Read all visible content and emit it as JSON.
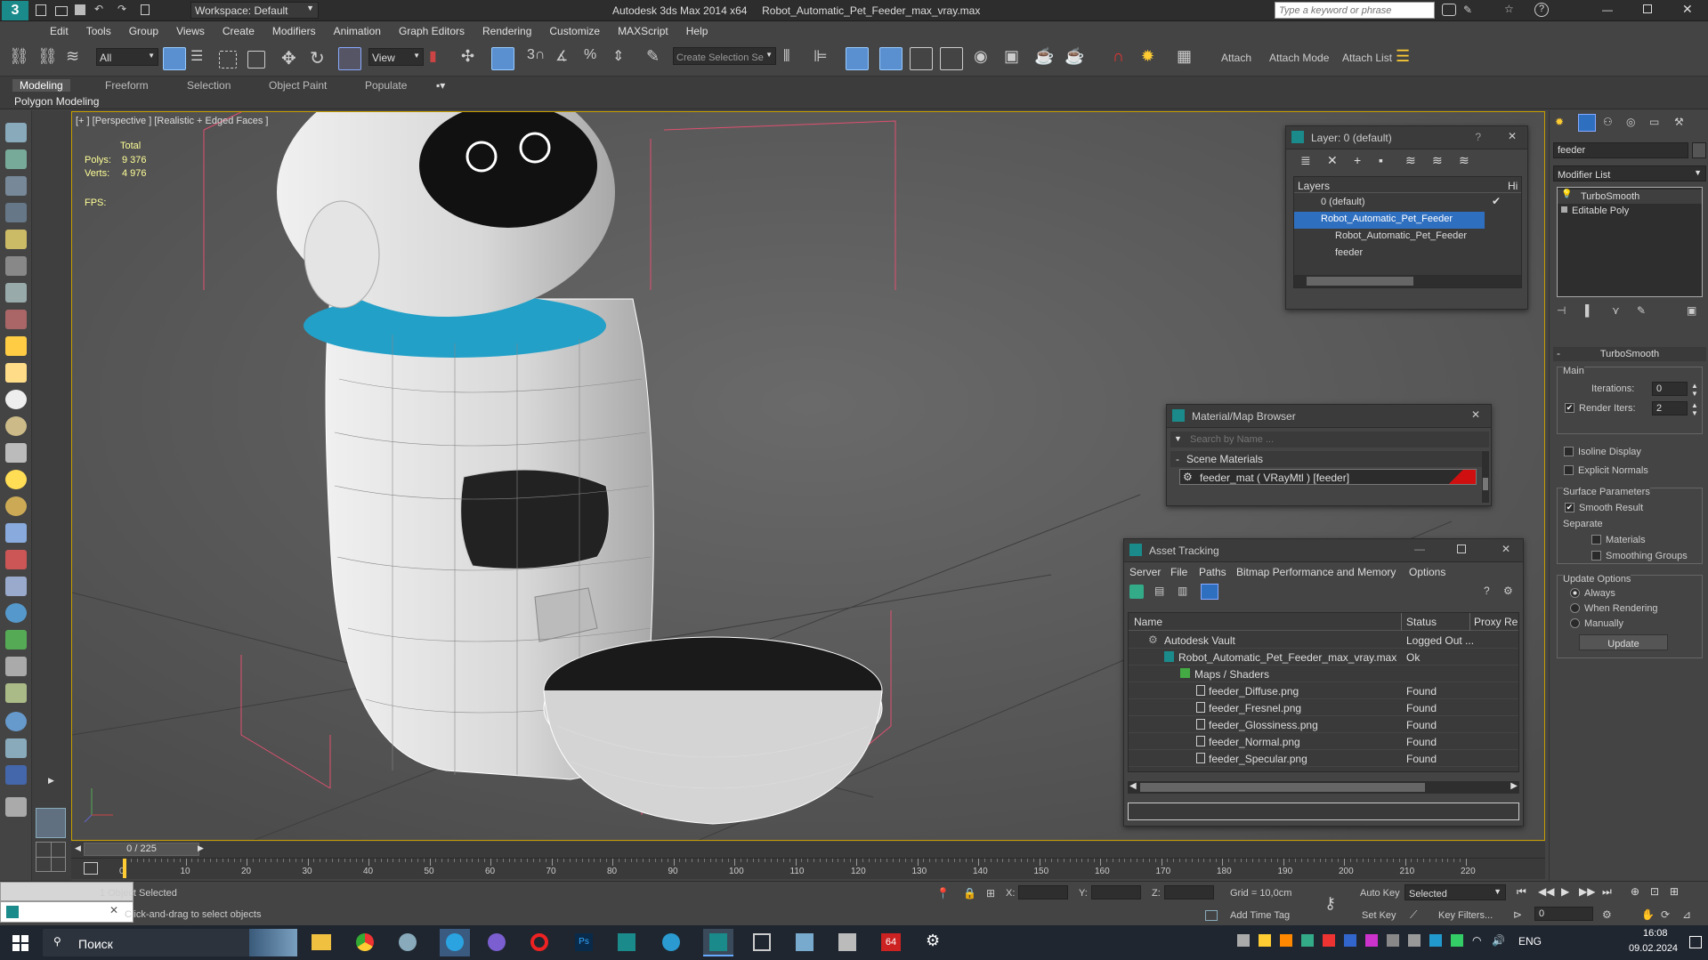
{
  "titlebar": {
    "workspace": "Workspace: Default",
    "app": "Autodesk 3ds Max  2014 x64",
    "file": "Robot_Automatic_Pet_Feeder_max_vray.max",
    "search_placeholder": "Type a keyword or phrase"
  },
  "menu": [
    "Edit",
    "Tools",
    "Group",
    "Views",
    "Create",
    "Modifiers",
    "Animation",
    "Graph Editors",
    "Rendering",
    "Customize",
    "MAXScript",
    "Help"
  ],
  "toolbar": {
    "filter": "All",
    "ref_coord": "View",
    "selection_set": "Create Selection Se",
    "attach": "Attach",
    "attach_mode": "Attach Mode",
    "attach_list": "Attach List"
  },
  "ribbon": {
    "tabs": [
      "Modeling",
      "Freeform",
      "Selection",
      "Object Paint",
      "Populate"
    ],
    "sub": "Polygon Modeling"
  },
  "viewport": {
    "label": "[+ ] [Perspective ] [Realistic + Edged Faces ]",
    "stats_total": "Total",
    "polys_label": "Polys:",
    "polys": "9 376",
    "verts_label": "Verts:",
    "verts": "4 976",
    "fps": "FPS:"
  },
  "layer_panel": {
    "title": "Layer: 0 (default)",
    "header": "Layers",
    "hide_col": "Hi",
    "items": [
      "0 (default)",
      "Robot_Automatic_Pet_Feeder",
      "Robot_Automatic_Pet_Feeder",
      "feeder"
    ]
  },
  "material_browser": {
    "title": "Material/Map Browser",
    "search_placeholder": "Search by Name ...",
    "section": "Scene Materials",
    "item": "feeder_mat  ( VRayMtl )  [feeder]",
    "swatch_color": "#d01010"
  },
  "asset_tracking": {
    "title": "Asset Tracking",
    "menu": [
      "Server",
      "File",
      "Paths",
      "Bitmap Performance and Memory",
      "Options"
    ],
    "columns": [
      "Name",
      "Status",
      "Proxy Re"
    ],
    "rows": [
      {
        "name": "Autodesk Vault",
        "status": "Logged Out ..."
      },
      {
        "name": "Robot_Automatic_Pet_Feeder_max_vray.max",
        "status": "Ok"
      },
      {
        "name": "Maps / Shaders",
        "status": ""
      },
      {
        "name": "feeder_Diffuse.png",
        "status": "Found"
      },
      {
        "name": "feeder_Fresnel.png",
        "status": "Found"
      },
      {
        "name": "feeder_Glossiness.png",
        "status": "Found"
      },
      {
        "name": "feeder_Normal.png",
        "status": "Found"
      },
      {
        "name": "feeder_Specular.png",
        "status": "Found"
      }
    ]
  },
  "command_panel": {
    "object_name": "feeder",
    "modifier_list": "Modifier List",
    "stack": [
      "TurboSmooth",
      "Editable Poly"
    ],
    "turbosmooth": {
      "title": "TurboSmooth",
      "main": "Main",
      "iterations_label": "Iterations:",
      "iterations": "0",
      "render_iters_label": "Render Iters:",
      "render_iters": "2",
      "isoline": "Isoline Display",
      "explicit": "Explicit Normals",
      "surface": "Surface Parameters",
      "smooth_result": "Smooth Result",
      "separate": "Separate",
      "materials": "Materials",
      "smoothing_groups": "Smoothing Groups",
      "update_options": "Update Options",
      "always": "Always",
      "when_rendering": "When Rendering",
      "manually": "Manually",
      "update": "Update"
    }
  },
  "timeline": {
    "frame": "0 / 225",
    "ticks": [
      "0",
      "10",
      "20",
      "30",
      "40",
      "50",
      "60",
      "70",
      "80",
      "90",
      "100",
      "110",
      "120",
      "130",
      "140",
      "150",
      "160",
      "170",
      "180",
      "190",
      "200",
      "210",
      "220"
    ]
  },
  "status": {
    "selected": "1 Object Selected",
    "prompt": "Click-and-drag to select objects",
    "x": "X:",
    "y": "Y:",
    "z": "Z:",
    "grid": "Grid = 10,0cm",
    "add_time_tag": "Add Time Tag",
    "auto_key": "Auto Key",
    "selected_dd": "Selected",
    "set_key": "Set Key",
    "key_filters": "Key Filters...",
    "frame_field": "0"
  },
  "taskbar": {
    "search": "Поиск",
    "lang": "ENG",
    "time": "16:08",
    "date": "09.02.2024"
  }
}
